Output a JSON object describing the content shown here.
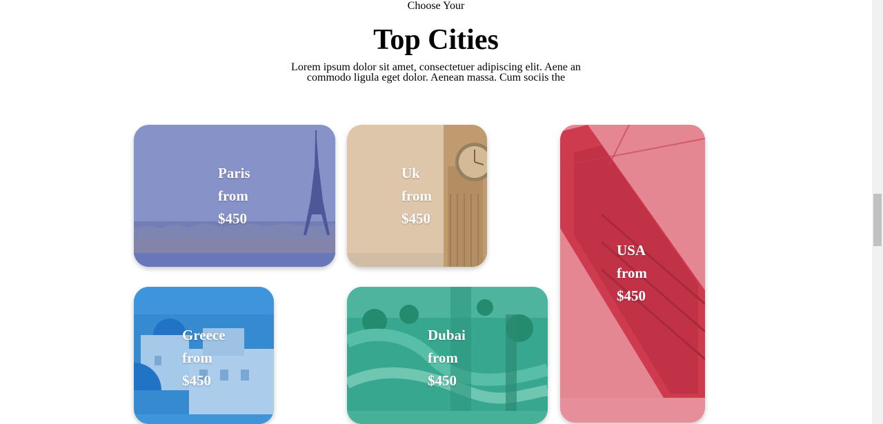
{
  "header": {
    "kicker": "Choose Your",
    "title": "Top Cities",
    "lede": "Lorem ipsum dolor sit amet, consectetuer adipiscing elit. Aene an commodo ligula eget dolor. Aenean massa. Cum sociis the"
  },
  "cards": [
    {
      "city": "Paris",
      "from": "from",
      "price": "$450",
      "tint": "#6f7dbe"
    },
    {
      "city": "Uk",
      "from": "from",
      "price": "$450",
      "tint": "#d9b99a"
    },
    {
      "city": "USA",
      "from": "from",
      "price": "$450",
      "tint": "#d84a5c"
    },
    {
      "city": "Greece",
      "from": "from",
      "price": "$450",
      "tint": "#2f86c8"
    },
    {
      "city": "Dubai",
      "from": "from",
      "price": "$450",
      "tint": "#2fa58f"
    }
  ]
}
